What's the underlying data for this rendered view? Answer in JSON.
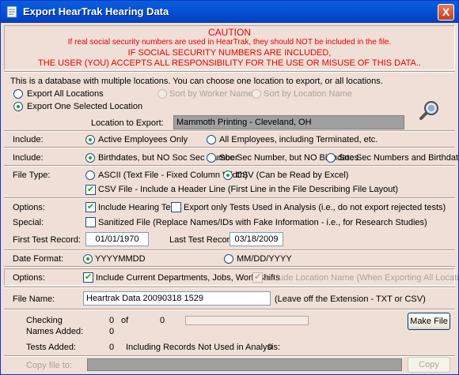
{
  "window": {
    "title": "Export HearTrak Hearing Data",
    "close_label": "X"
  },
  "caution": {
    "heading": "CAUTION",
    "line1": "If real social security numbers are used in HearTrak, they should NOT be included in the file.",
    "line2": "IF SOCIAL SECURITY NUMBERS ARE INCLUDED,",
    "line3": "THE USER (YOU) ACCEPTS ALL RESPONSIBILITY FOR THE USE OR MISUSE OF THIS DATA.."
  },
  "locations": {
    "intro": "This is a database with multiple locations.  You can choose one location to export, or all locations.",
    "export_all": "Export All Locations",
    "sort_worker": "Sort by Worker Name",
    "sort_location": "Sort by Location Name",
    "export_one": "Export One Selected Location",
    "location_label": "Location to Export:",
    "location_value": "Mammoth Printing - Cleveland, OH"
  },
  "include1": {
    "label": "Include:",
    "active": "Active Employees Only",
    "all": "All Employees, including Terminated, etc."
  },
  "include2": {
    "label": "Include:",
    "birthdates": "Birthdates, but NO Soc Sec Number",
    "ssn": "Soc Sec Number, but NO Birthdates",
    "both": "Soc Sec Numbers and Birthdates"
  },
  "filetype": {
    "label": "File Type:",
    "ascii": "ASCII (Text File - Fixed Column Width)",
    "csv": "CSV (Can be Read by Excel)",
    "header": "CSV File - Include a Header Line (First Line in the File Describing File Layout)"
  },
  "options1": {
    "label": "Options:",
    "hearing_tests": "Include Hearing Tests",
    "export_only": "Export only Tests Used in Analysis (i.e., do not export rejected tests)",
    "special_label": "Special:",
    "sanitized": "Sanitized File (Replace Names/IDs with Fake Information - i.e., for Research Studies)",
    "first_label": "First Test Record:",
    "first_value": "01/01/1970",
    "last_label": "Last Test Record:",
    "last_value": "03/18/2009"
  },
  "dateformat": {
    "label": "Date Format:",
    "ymd": "YYYYMMDD",
    "mdy": "MM/DD/YYYY"
  },
  "options2": {
    "label": "Options:",
    "current_depts": "Include Current Departments, Jobs, Work Shifts",
    "location_name": "Include Location Name (When Exporting All Locations)"
  },
  "filename": {
    "label": "File Name:",
    "value": "Heartrak Data 20090318 1529",
    "hint": "(Leave off the Extension -  TXT or CSV)"
  },
  "status": {
    "checking_label": "Checking",
    "checking_value": "0",
    "of_label": "of",
    "of_value": "0",
    "names_label": "Names Added:",
    "names_value": "0",
    "tests_label": "Tests Added:",
    "tests_value": "0",
    "including_label": "Including Records Not Used in Analysis:",
    "including_value": "0",
    "progress_fraction": 0,
    "make_file": "Make File"
  },
  "copy": {
    "label": "Copy file to:",
    "value": "",
    "button": "Copy"
  }
}
